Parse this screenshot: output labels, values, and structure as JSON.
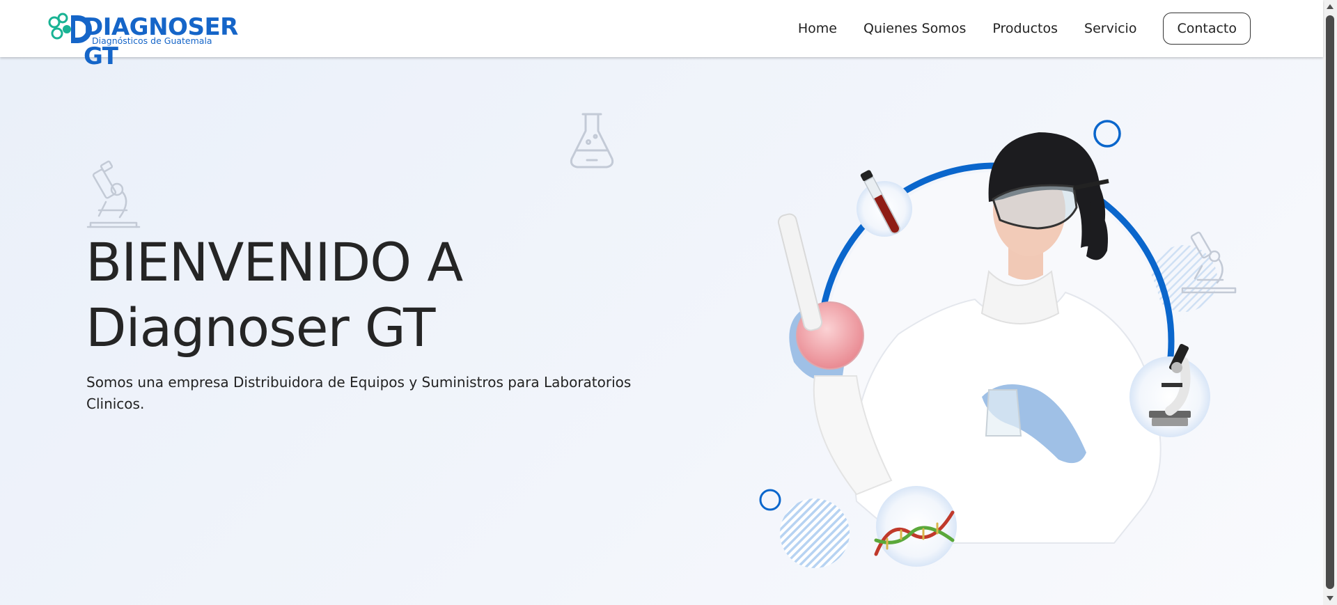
{
  "header": {
    "logo_title": "DIAGNOSER GT",
    "logo_subtitle": "Diagnósticos de Guatemala",
    "nav": {
      "home": "Home",
      "about": "Quienes Somos",
      "products": "Productos",
      "service": "Servicio",
      "contact": "Contacto"
    }
  },
  "hero": {
    "title_line1": "BIENVENIDO A",
    "title_line2": "Diagnoser GT",
    "description": "Somos una empresa Distribuidora de Equipos y Suministros para Laboratorios Clinicos."
  },
  "icons": {
    "flask": "flask-icon",
    "microscope": "microscope-icon",
    "test_tube": "test-tube-icon",
    "dna": "dna-icon"
  },
  "colors": {
    "brand_blue": "#1565c8",
    "logo_green": "#19b394",
    "text_dark": "#252525",
    "ring_blue": "#0a66cc"
  }
}
